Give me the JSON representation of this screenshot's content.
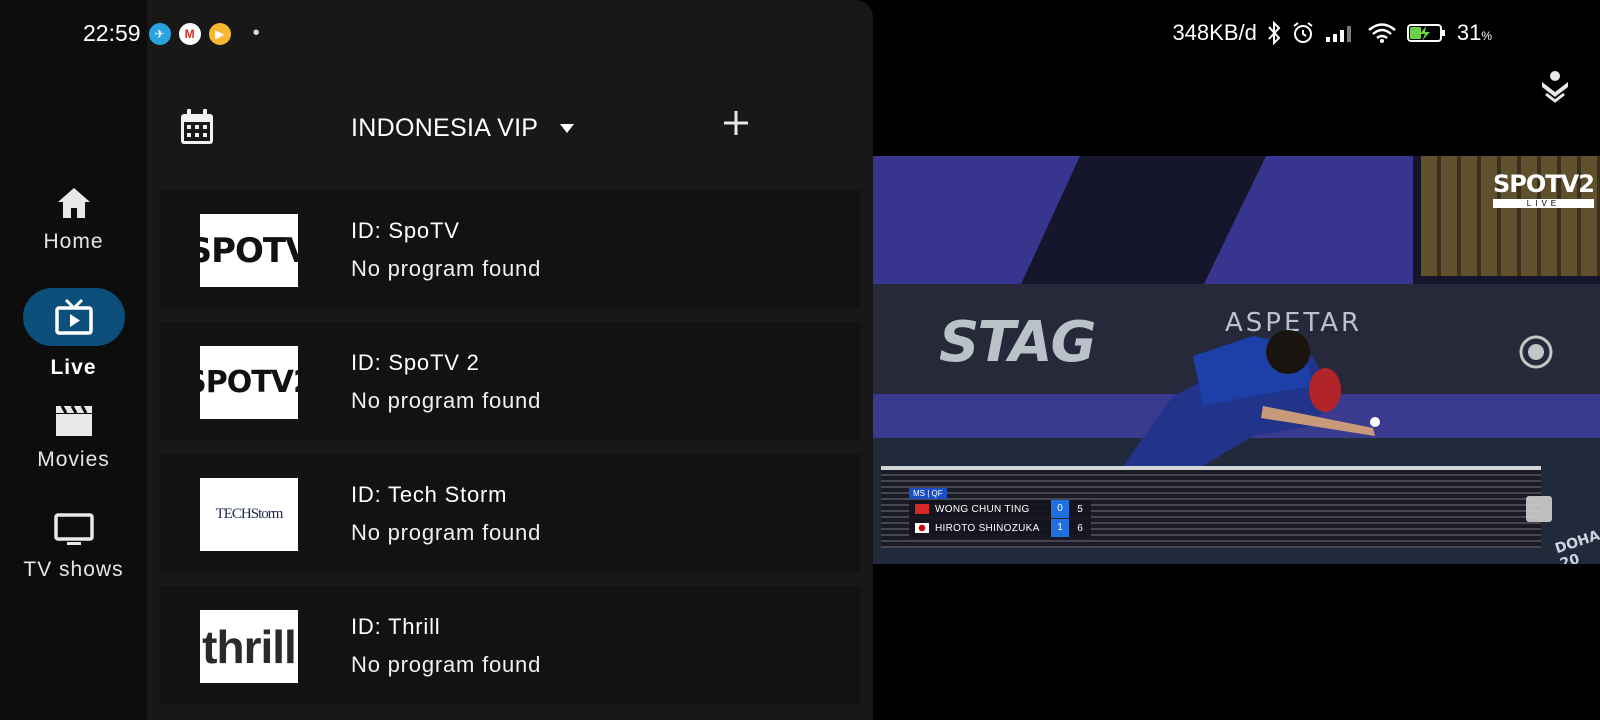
{
  "status_bar": {
    "time": "22:59",
    "notification_icons": [
      "telegram-icon",
      "gmail-icon",
      "player-icon"
    ],
    "notification_letters": {
      "telegram": "✈",
      "gmail": "M",
      "player": "▶"
    },
    "more_dot": "•",
    "data_rate": "348KB/d",
    "battery_percent": "31",
    "battery_unit": "%"
  },
  "nav": {
    "items": [
      {
        "label": "Home",
        "icon": "home-icon",
        "active": false
      },
      {
        "label": "Live",
        "icon": "tv-live-icon",
        "active": true
      },
      {
        "label": "Movies",
        "icon": "clapperboard-icon",
        "active": false
      },
      {
        "label": "TV shows",
        "icon": "monitor-icon",
        "active": false
      }
    ]
  },
  "toolbar": {
    "calendar_icon": "calendar-icon",
    "playlist_name": "INDONESIA VIP",
    "dropdown_icon": "caret-down-icon",
    "add_icon": "plus-icon"
  },
  "channels": [
    {
      "logo_text": "SPOTV",
      "id_text": "ID: SpoTV",
      "program": "No program found"
    },
    {
      "logo_text": "SPOTV2",
      "id_text": "ID: SpoTV 2",
      "program": "No program found"
    },
    {
      "logo_text": "TECHStorm",
      "id_text": "ID: Tech Storm",
      "program": "No program found"
    },
    {
      "logo_text": "thrill",
      "id_text": "ID: Thrill",
      "program": "No program found"
    }
  ],
  "video": {
    "channel_badge": "SPOTV2",
    "channel_badge_sub": "LIVE",
    "board_texts": [
      "STAG",
      "ASPETAR",
      "DOHA 20"
    ],
    "scoreboard": {
      "tag": "MS | QF",
      "players": [
        {
          "name": "WONG CHUN TING",
          "sets": "0",
          "points": "5"
        },
        {
          "name": "HIROTO SHINOZUKA",
          "sets": "1",
          "points": "6"
        }
      ]
    }
  },
  "colors": {
    "nav_active_pill": "#0b4f7a",
    "panel_bg": "#181818",
    "row_bg": "#121212",
    "score_blue": "#1e6fe0"
  }
}
